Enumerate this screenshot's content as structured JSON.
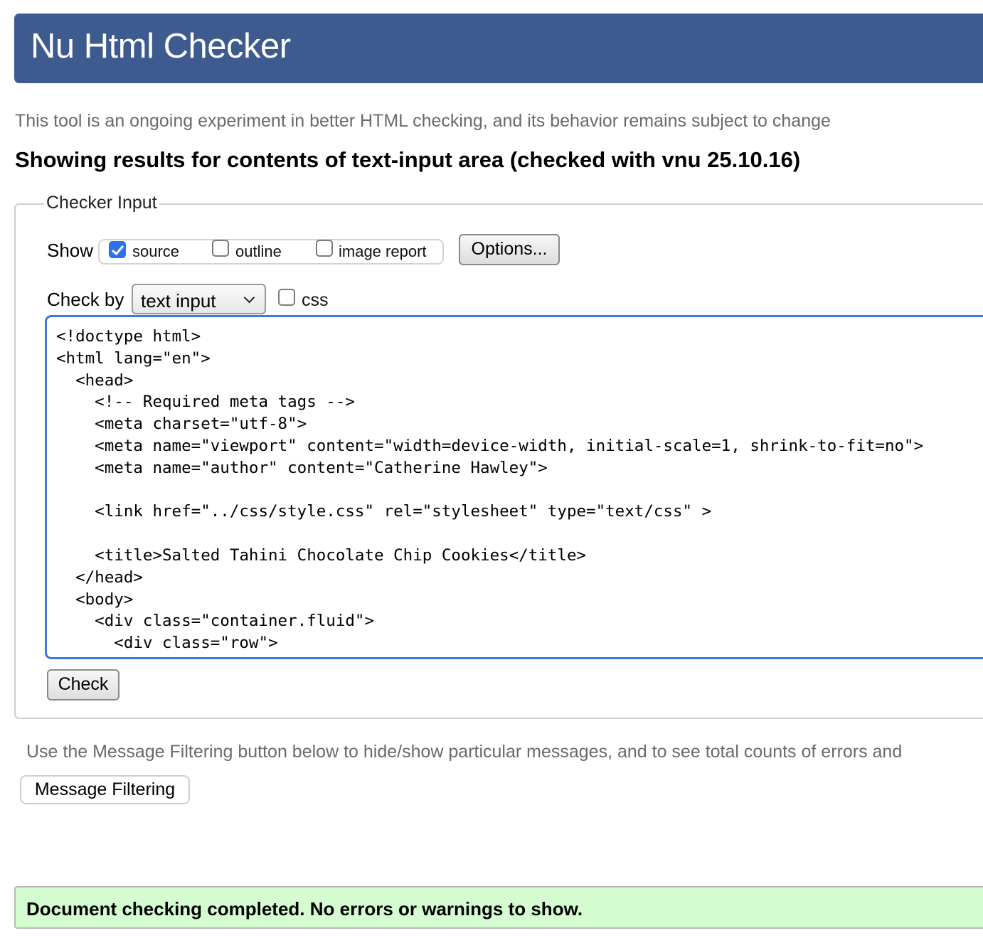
{
  "header": {
    "title": "Nu Html Checker"
  },
  "subtitle": "This tool is an ongoing experiment in better HTML checking, and its behavior remains subject to change",
  "results_heading": "Showing results for contents of text-input area (checked with vnu 25.10.16)",
  "checker_input": {
    "legend": "Checker Input",
    "show_label": "Show",
    "show_options": [
      {
        "label": "source",
        "checked": true
      },
      {
        "label": "outline",
        "checked": false
      },
      {
        "label": "image report",
        "checked": false
      }
    ],
    "options_button": "Options...",
    "check_by_label": "Check by",
    "check_by_selected": "text input",
    "css_checkbox": {
      "label": "css",
      "checked": false
    },
    "source_lines": [
      "<!doctype html>",
      "<html lang=\"en\">",
      "  <head>",
      "    <!-- Required meta tags -->",
      "    <meta charset=\"utf-8\">",
      "    <meta name=\"viewport\" content=\"width=device-width, initial-scale=1, shrink-to-fit=no\">",
      "    <meta name=\"author\" content=\"Catherine Hawley\">",
      "",
      "    <link href=\"../css/style.css\" rel=\"stylesheet\" type=\"text/css\" >",
      "",
      "    <title>Salted Tahini Chocolate Chip Cookies</title>",
      "  </head>",
      "  <body>",
      "    <div class=\"container.fluid\">",
      "      <div class=\"row\">"
    ],
    "check_button": "Check"
  },
  "filter_note": "Use the Message Filtering button below to hide/show particular messages, and to see total counts of errors and",
  "message_filtering_button": "Message Filtering",
  "status": {
    "message": "Document checking completed. No errors or warnings to show.",
    "color": "#d5fcd0"
  },
  "colors": {
    "header_bg": "#3d5b8f",
    "focus_border": "#3b7ad9",
    "checkbox_checked": "#2c71e8"
  }
}
